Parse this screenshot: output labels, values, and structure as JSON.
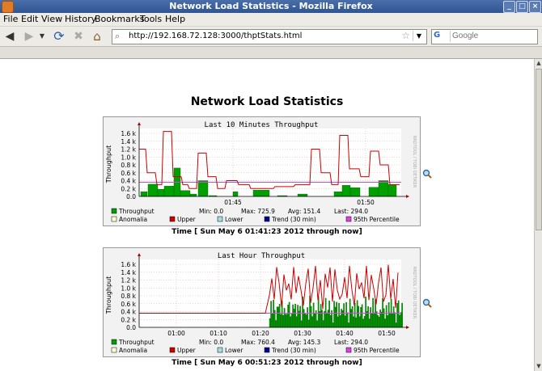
{
  "window": {
    "title": "Network Load Statistics - Mozilla Firefox"
  },
  "menu": [
    "File",
    "Edit",
    "View",
    "History",
    "Bookmarks",
    "Tools",
    "Help"
  ],
  "address": {
    "url": "http://192.168.72.128:3000/thptStats.html"
  },
  "search": {
    "placeholder": "Google",
    "engine": "G"
  },
  "page": {
    "title": "Network Load Statistics"
  },
  "graph1": {
    "title": "Last 10 Minutes Throughput",
    "ylabel": "Throughput",
    "side_text": "RRDTOOL / TOBI OETIKER",
    "yticks": [
      "0.0",
      "0.2 k",
      "0.4 k",
      "0.6 k",
      "0.8 k",
      "1.0 k",
      "1.2 k",
      "1.4 k",
      "1.6 k"
    ],
    "xticks": [
      "01:45",
      "01:50"
    ],
    "legend": {
      "throughput": "Throughput",
      "anomalia": "Anomalia",
      "upper": "Upper",
      "lower": "Lower",
      "trend": "Trend (30 min)",
      "p95": "95th Percentile",
      "min": "Min: 0.0",
      "max": "Max: 725.9",
      "avg": "Avg: 151.4",
      "last": "Last: 294.0"
    },
    "caption": "Time [ Sun May 6 01:41:23 2012 through now]"
  },
  "graph2": {
    "title": "Last Hour Throughput",
    "ylabel": "Throughput",
    "side_text": "RRDTOOL / TOBI OETIKER",
    "yticks": [
      "0.0",
      "0.2 k",
      "0.4 k",
      "0.6 k",
      "0.8 k",
      "1.0 k",
      "1.2 k",
      "1.4 k",
      "1.6 k"
    ],
    "xticks": [
      "01:00",
      "01:10",
      "01:20",
      "01:30",
      "01:40",
      "01:50"
    ],
    "legend": {
      "throughput": "Throughput",
      "anomalia": "Anomalia",
      "upper": "Upper",
      "lower": "Lower",
      "trend": "Trend (30 min)",
      "p95": "95th Percentile",
      "min": "Min: 0.0",
      "max": "Max: 760.4",
      "avg": "Avg: 145.3",
      "last": "Last: 294.0"
    },
    "caption": "Time [ Sun May 6 00:51:23 2012 through now]"
  },
  "colors": {
    "throughput": "#00a000",
    "upper": "#cc0000",
    "p95": "#e040e0",
    "trend": "#000090",
    "lower": "#a0e0e0"
  },
  "icons": [
    "firefox-icon",
    "back-icon",
    "forward-icon",
    "reload-icon",
    "stop-icon",
    "home-icon",
    "magnifier-icon"
  ]
}
